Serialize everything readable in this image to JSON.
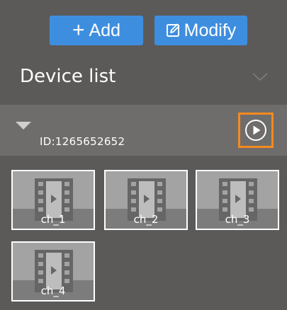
{
  "toolbar": {
    "add_label": "Add",
    "modify_label": "Modify"
  },
  "device_list": {
    "title": "Device list"
  },
  "device": {
    "id_text": "ID:1265652652"
  },
  "channels": [
    {
      "label": "ch_1"
    },
    {
      "label": "ch_2"
    },
    {
      "label": "ch_3"
    },
    {
      "label": "ch_4"
    }
  ],
  "colors": {
    "button_blue": "#3e8ee0",
    "highlight_orange": "#f58a1f",
    "background": "#5b5a58"
  },
  "icons": {
    "add": "plus-icon",
    "modify": "edit-icon",
    "collapse": "chevron-down-icon",
    "expand": "triangle-down-icon",
    "play": "play-circle-icon",
    "channel": "film-play-icon"
  }
}
